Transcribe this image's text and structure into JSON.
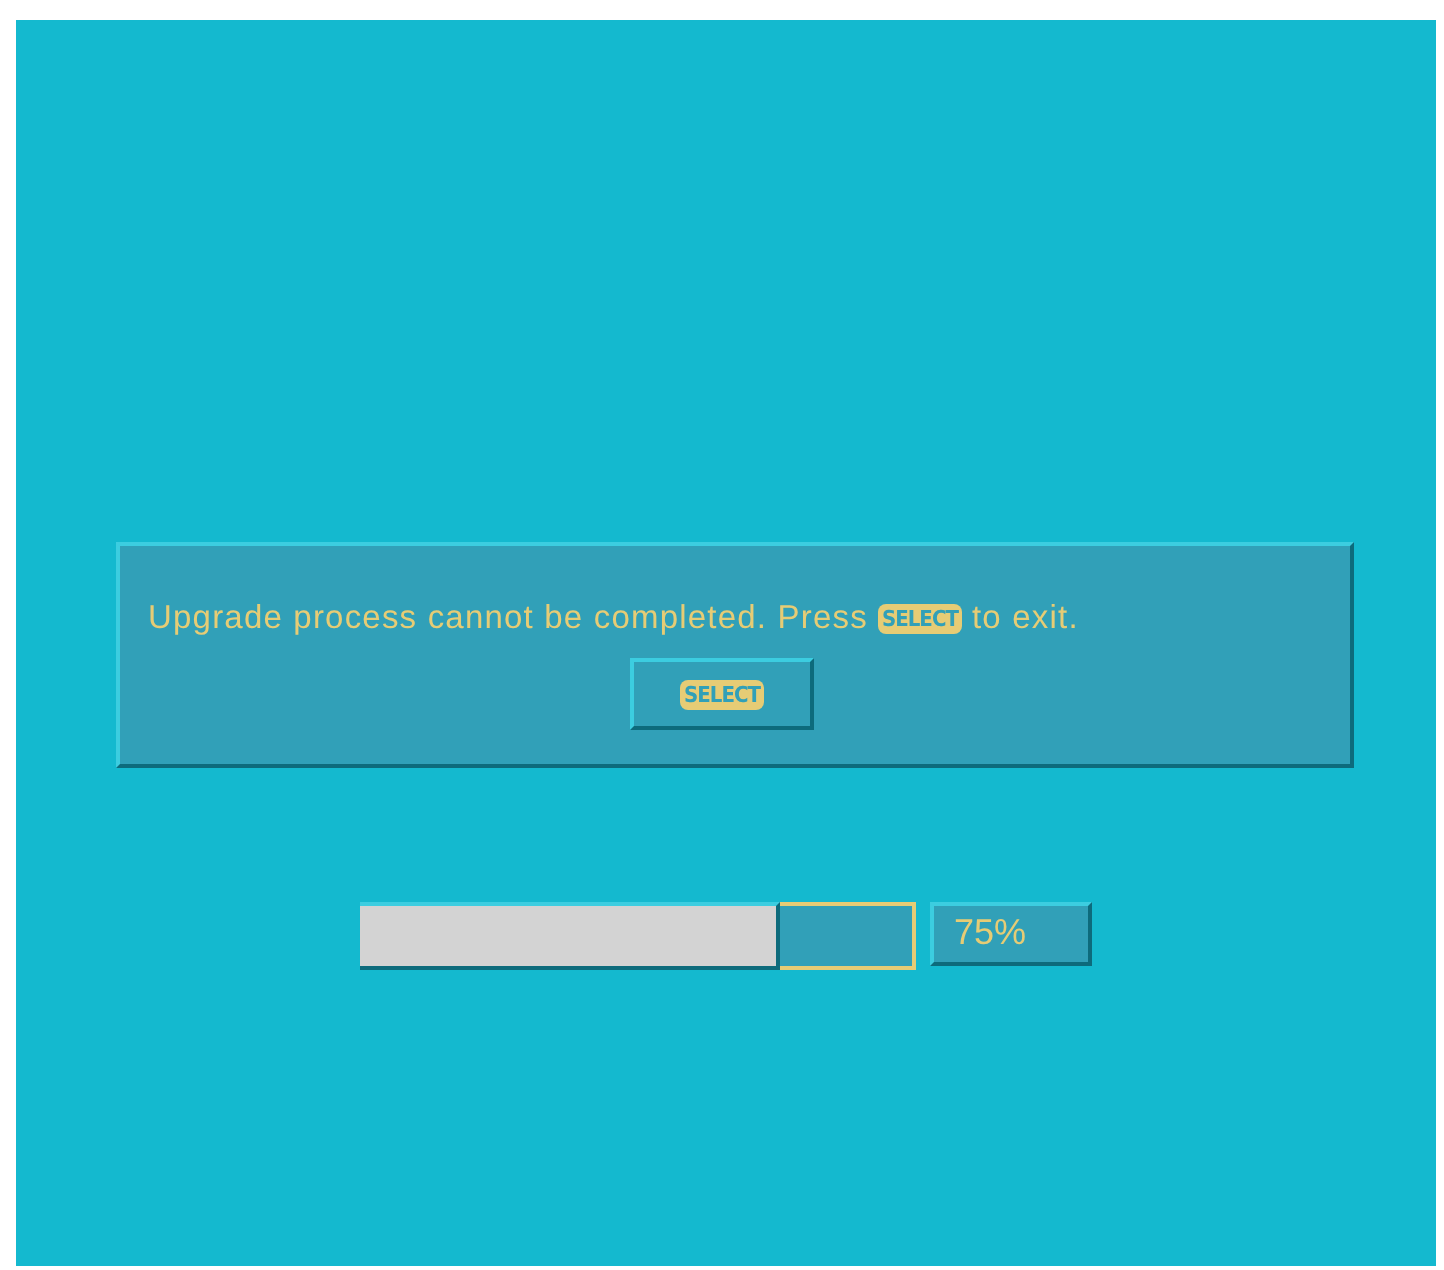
{
  "dialog": {
    "message": {
      "before": "Upgrade process cannot be completed. Press",
      "key": "SELECT",
      "after": "to exit."
    },
    "button": {
      "label": "SELECT"
    }
  },
  "progress": {
    "level": 0.75,
    "reading": "75%"
  }
}
